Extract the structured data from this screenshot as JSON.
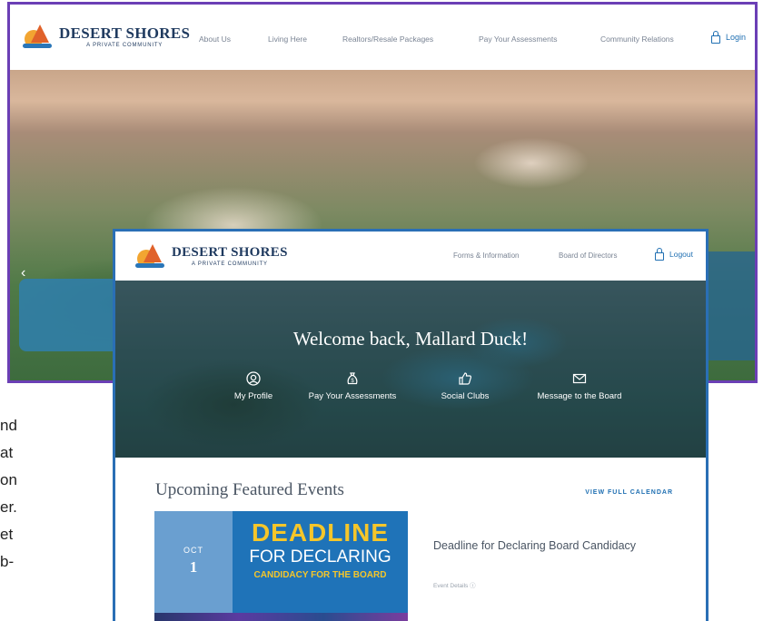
{
  "back_window": {
    "logo": {
      "title": "DESERT SHORES",
      "subtitle": "A PRIVATE COMMUNITY"
    },
    "nav": [
      "About Us",
      "Living Here",
      "Realtors/Resale Packages",
      "Pay Your Assessments",
      "Community Relations"
    ],
    "login_label": "Login",
    "carousel_prev": "‹"
  },
  "front_window": {
    "logo": {
      "title": "DESERT SHORES",
      "subtitle": "A PRIVATE COMMUNITY"
    },
    "nav": [
      "Forms & Information",
      "Board of Directors"
    ],
    "logout_label": "Logout",
    "welcome": "Welcome back, Mallard Duck!",
    "quick_actions": [
      {
        "label": "My Profile",
        "icon": "profile-icon"
      },
      {
        "label": "Pay Your Assessments",
        "icon": "money-bag-icon"
      },
      {
        "label": "Social Clubs",
        "icon": "thumbs-up-icon"
      },
      {
        "label": "Message to the Board",
        "icon": "envelope-icon"
      }
    ],
    "events": {
      "heading": "Upcoming Featured Events",
      "calendar_link": "VIEW FULL CALENDAR",
      "items": [
        {
          "month": "OCT",
          "day": "1",
          "banner_line1": "DEADLINE",
          "banner_line2": "FOR DECLARING",
          "banner_line3": "CANDIDACY FOR THE BOARD",
          "title": "Deadline for Declaring Board Candidacy",
          "details": "Event Details ⓘ"
        }
      ]
    }
  },
  "side_text": [
    "nd",
    "at",
    "on",
    "er.",
    "et",
    "b-"
  ],
  "colors": {
    "back_border": "#6b3fb5",
    "front_border": "#2a6fb5",
    "accent": "#1f6fb2",
    "date_box": "#6a9fd0",
    "banner_yellow": "#f5c62a"
  }
}
